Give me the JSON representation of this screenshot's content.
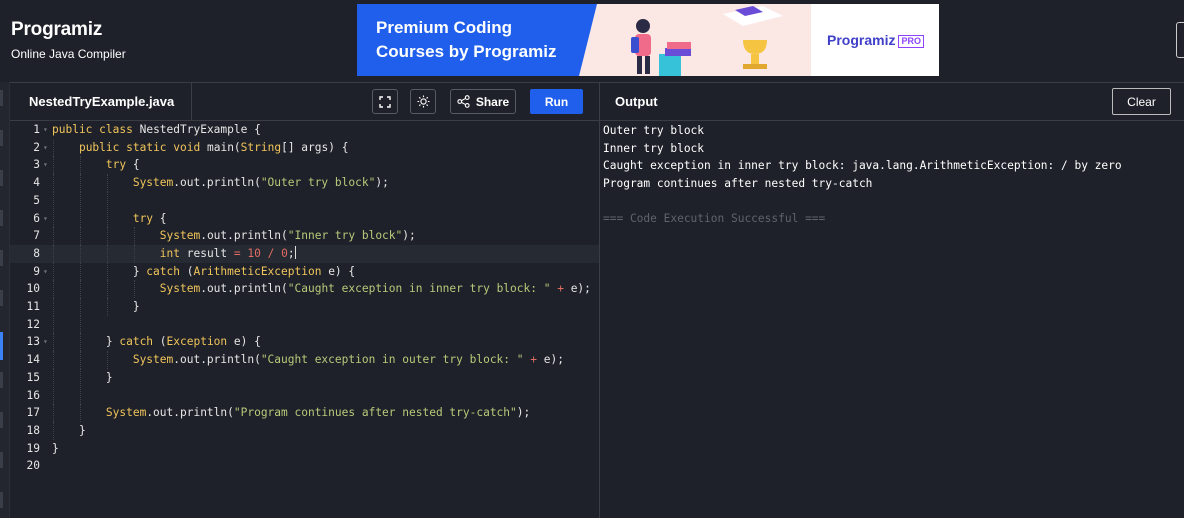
{
  "header": {
    "logo": "Programiz",
    "tagline": "Online Java Compiler",
    "ad": {
      "line1": "Premium Coding",
      "line2": "Courses by Programiz",
      "brand": "Programiz",
      "pro_badge": "PRO"
    }
  },
  "editor": {
    "file_name": "NestedTryExample.java",
    "fullscreen_icon": "fullscreen-icon",
    "theme_icon": "sun-icon",
    "share_label": "Share",
    "run_label": "Run",
    "active_line": 8,
    "lines": [
      {
        "n": "1",
        "text": "public class NestedTryExample {"
      },
      {
        "n": "2",
        "text": "    public static void main(String[] args) {"
      },
      {
        "n": "3",
        "text": "        try {"
      },
      {
        "n": "4",
        "text": "            System.out.println(\"Outer try block\");"
      },
      {
        "n": "5",
        "text": ""
      },
      {
        "n": "6",
        "text": "            try {"
      },
      {
        "n": "7",
        "text": "                System.out.println(\"Inner try block\");"
      },
      {
        "n": "8",
        "text": "                int result = 10 / 0;"
      },
      {
        "n": "9",
        "text": "            } catch (ArithmeticException e) {"
      },
      {
        "n": "10",
        "text": "                System.out.println(\"Caught exception in inner try block: \" + e);"
      },
      {
        "n": "11",
        "text": "            }"
      },
      {
        "n": "12",
        "text": ""
      },
      {
        "n": "13",
        "text": "        } catch (Exception e) {"
      },
      {
        "n": "14",
        "text": "            System.out.println(\"Caught exception in outer try block: \" + e);"
      },
      {
        "n": "15",
        "text": "        }"
      },
      {
        "n": "16",
        "text": ""
      },
      {
        "n": "17",
        "text": "        System.out.println(\"Program continues after nested try-catch\");"
      },
      {
        "n": "18",
        "text": "    }"
      },
      {
        "n": "19",
        "text": "}"
      },
      {
        "n": "20",
        "text": ""
      }
    ]
  },
  "output": {
    "title": "Output",
    "clear_label": "Clear",
    "lines": [
      "Outer try block",
      "Inner try block",
      "Caught exception in inner try block: java.lang.ArithmeticException: / by zero",
      "Program continues after nested try-catch",
      "",
      "=== Code Execution Successful ==="
    ]
  },
  "colors": {
    "background": "#1e2129",
    "accent": "#1f5fec",
    "keyword": "#f1c55b",
    "string": "#b9c97a",
    "number": "#e06c62"
  }
}
